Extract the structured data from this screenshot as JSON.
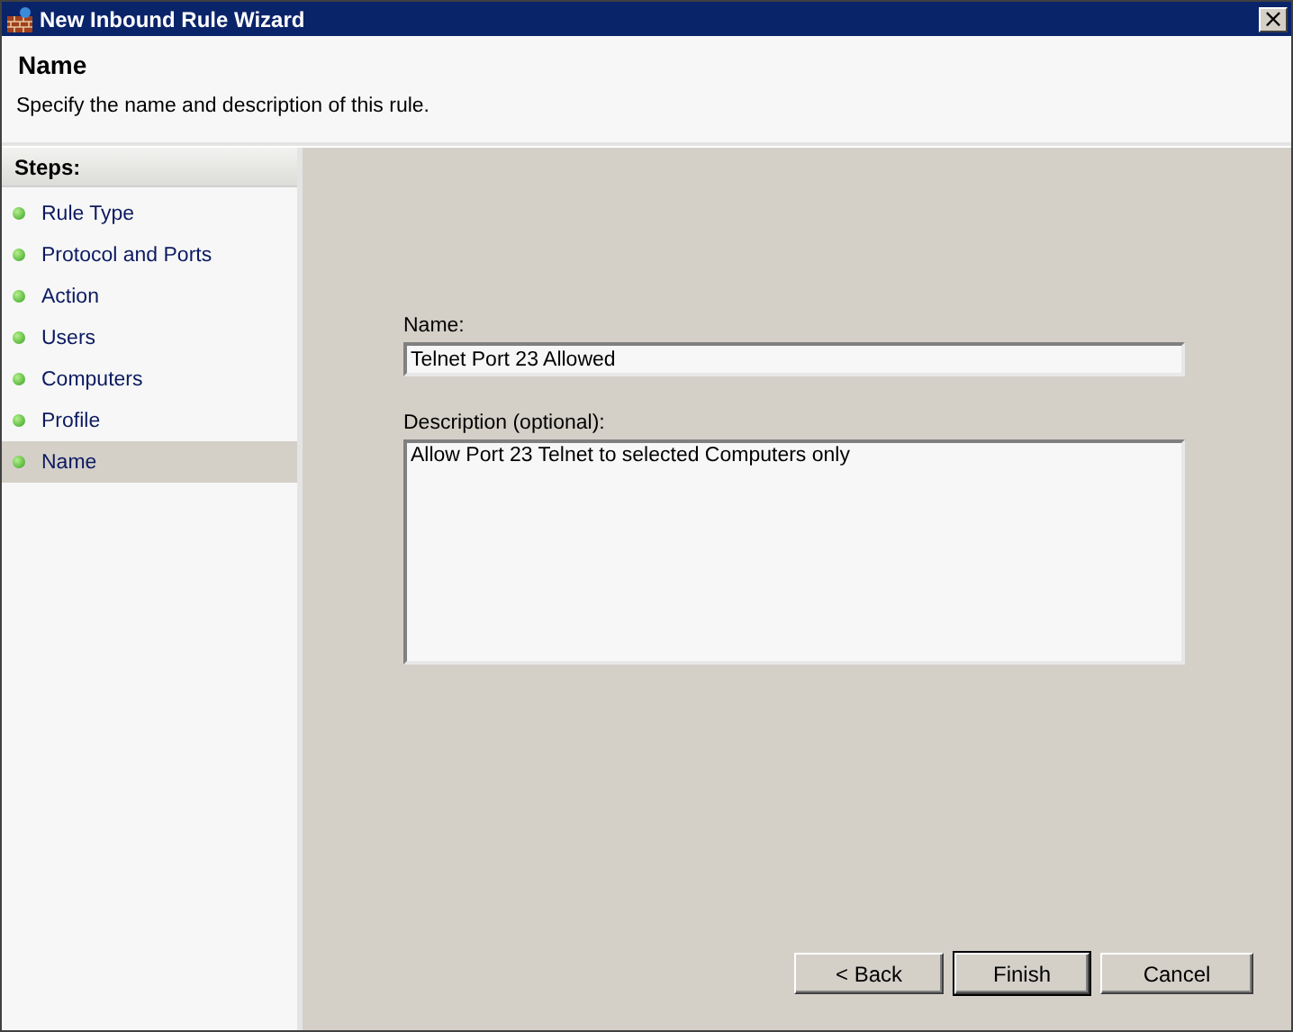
{
  "window": {
    "title": "New Inbound Rule Wizard",
    "close": "×"
  },
  "header": {
    "title": "Name",
    "subtitle": "Specify the name and description of this rule."
  },
  "steps": {
    "heading": "Steps:",
    "items": [
      {
        "label": "Rule Type",
        "selected": false
      },
      {
        "label": "Protocol and Ports",
        "selected": false
      },
      {
        "label": "Action",
        "selected": false
      },
      {
        "label": "Users",
        "selected": false
      },
      {
        "label": "Computers",
        "selected": false
      },
      {
        "label": "Profile",
        "selected": false
      },
      {
        "label": "Name",
        "selected": true
      }
    ]
  },
  "form": {
    "name_label": "Name:",
    "name_value": "Telnet Port 23 Allowed",
    "description_label": "Description (optional):",
    "description_value": "Allow Port 23 Telnet to selected Computers only"
  },
  "buttons": [
    {
      "label": "< Back",
      "default": false
    },
    {
      "label": "Finish",
      "default": true
    },
    {
      "label": "Cancel",
      "default": false
    }
  ]
}
